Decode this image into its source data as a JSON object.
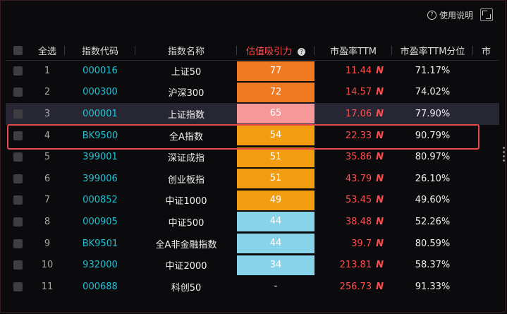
{
  "topbar": {
    "help_label": "使用说明",
    "help_icon": "question-icon",
    "fullscreen_icon": "fullscreen-icon"
  },
  "columns": {
    "select_all": "全选",
    "code": "指数代码",
    "name": "指数名称",
    "attraction": "估值吸引力",
    "pe": "市盈率TTM",
    "pe_pct": "市盈率TTM分位",
    "extra": "市"
  },
  "colors": {
    "accent_red": "#ff4d4f",
    "code_cyan": "#20c2d6",
    "score_deep_orange": "#f07a21",
    "score_pink": "#f6989a",
    "score_orange": "#f29d10",
    "score_blue": "#86d3ea",
    "highlight_box": "#e34a48"
  },
  "rows": [
    {
      "idx": "1",
      "code": "000016",
      "name": "上证50",
      "score": "77",
      "color": "#f07a21",
      "pe": "11.44",
      "pct": "71.17%"
    },
    {
      "idx": "2",
      "code": "000300",
      "name": "沪深300",
      "score": "72",
      "color": "#f07a21",
      "pe": "14.57",
      "pct": "74.02%"
    },
    {
      "idx": "3",
      "code": "000001",
      "name": "上证指数",
      "score": "65",
      "color": "#f6989a",
      "pe": "17.06",
      "pct": "77.90%"
    },
    {
      "idx": "4",
      "code": "BK9500",
      "name": "全A指数",
      "score": "54",
      "color": "#f29d10",
      "pe": "22.33",
      "pct": "90.79%"
    },
    {
      "idx": "5",
      "code": "399001",
      "name": "深证成指",
      "score": "51",
      "color": "#f29d10",
      "pe": "35.86",
      "pct": "80.97%"
    },
    {
      "idx": "6",
      "code": "399006",
      "name": "创业板指",
      "score": "51",
      "color": "#f29d10",
      "pe": "43.79",
      "pct": "26.10%"
    },
    {
      "idx": "7",
      "code": "000852",
      "name": "中证1000",
      "score": "49",
      "color": "#f29d10",
      "pe": "53.45",
      "pct": "49.60%"
    },
    {
      "idx": "8",
      "code": "000905",
      "name": "中证500",
      "score": "44",
      "color": "#86d3ea",
      "pe": "38.48",
      "pct": "52.26%"
    },
    {
      "idx": "9",
      "code": "BK9501",
      "name": "全A非金融指数",
      "score": "44",
      "color": "#86d3ea",
      "pe": "39.7",
      "pct": "80.59%"
    },
    {
      "idx": "10",
      "code": "932000",
      "name": "中证2000",
      "score": "34",
      "color": "#86d3ea",
      "pe": "213.81",
      "pct": "58.37%"
    },
    {
      "idx": "11",
      "code": "000688",
      "name": "科创50",
      "score": "-",
      "color": "",
      "pe": "256.73",
      "pct": "91.33%"
    }
  ]
}
